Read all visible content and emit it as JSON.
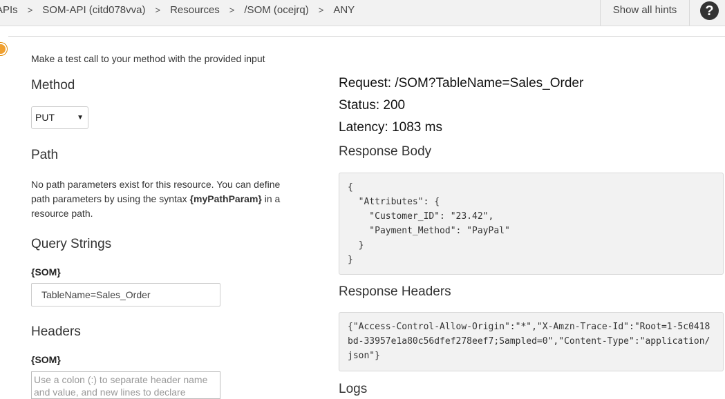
{
  "breadcrumb": {
    "items": [
      "APIs",
      "SOM-API (citd078vva)",
      "Resources",
      "/SOM (ocejrq)",
      "ANY"
    ],
    "separator": ">"
  },
  "header": {
    "hints_label": "Show all hints",
    "help_label": "?"
  },
  "intro": "Make a test call to your method with the provided input",
  "method": {
    "heading": "Method",
    "selected": "PUT"
  },
  "path": {
    "heading": "Path",
    "text_1": "No path parameters exist for this resource. You can define path parameters by using the syntax ",
    "syntax": "{myPathParam}",
    "text_2": " in a resource path."
  },
  "query_strings": {
    "heading": "Query Strings",
    "label": "{SOM}",
    "value": "TableName=Sales_Order"
  },
  "headers": {
    "heading": "Headers",
    "label": "{SOM}",
    "placeholder": "Use a colon (:) to separate header name and value, and new lines to declare multiple headers. eg. Accept:application/json"
  },
  "response": {
    "request_line": "Request: /SOM?TableName=Sales_Order",
    "status_line": "Status: 200",
    "latency_line": "Latency: 1083 ms",
    "body_heading": "Response Body",
    "body": "{\n  \"Attributes\": {\n    \"Customer_ID\": \"23.42\",\n    \"Payment_Method\": \"PayPal\"\n  }\n}",
    "headers_heading": "Response Headers",
    "headers_body": "{\"Access-Control-Allow-Origin\":\"*\",\"X-Amzn-Trace-Id\":\"Root=1-5c0418bd-33957e1a80c56dfef278eef7;Sampled=0\",\"Content-Type\":\"application/json\"}",
    "logs_heading": "Logs"
  },
  "colors": {
    "topbar": "#f2f2f2",
    "code_bg": "#f2f2f2",
    "indicator": "#f0a030"
  }
}
